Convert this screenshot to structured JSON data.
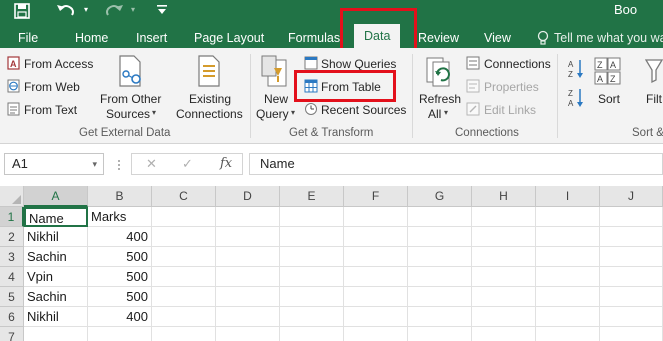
{
  "colors": {
    "accent": "#217346",
    "highlight": "#e3101b",
    "ribbon_bg": "#f3f3f3"
  },
  "quick_access": {
    "save_icon": "save-icon",
    "undo_icon": "undo-icon",
    "redo_icon": "redo-icon"
  },
  "window": {
    "title": "Boo"
  },
  "tabs": [
    {
      "label": "File"
    },
    {
      "label": "Home"
    },
    {
      "label": "Insert"
    },
    {
      "label": "Page Layout"
    },
    {
      "label": "Formulas"
    },
    {
      "label": "Data",
      "active": true
    },
    {
      "label": "Review"
    },
    {
      "label": "View"
    }
  ],
  "tell_me": "Tell me what you wa",
  "ribbon": {
    "get_external": {
      "from_access": "From Access",
      "from_web": "From Web",
      "from_text": "From Text",
      "from_other_1": "From Other",
      "from_other_2": "Sources",
      "existing_1": "Existing",
      "existing_2": "Connections",
      "label": "Get External Data"
    },
    "transform": {
      "new_query_1": "New",
      "new_query_2": "Query",
      "show_queries": "Show Queries",
      "from_table": "From Table",
      "recent_sources": "Recent Sources",
      "label": "Get & Transform"
    },
    "connections": {
      "refresh_1": "Refresh",
      "refresh_2": "All",
      "connections": "Connections",
      "properties": "Properties",
      "edit_links": "Edit Links",
      "label": "Connections"
    },
    "sort": {
      "sort": "Sort",
      "filter": "Filt",
      "label": "Sort &"
    }
  },
  "formula_bar": {
    "name_box": "A1",
    "fx": "fx",
    "content": "Name"
  },
  "sheet": {
    "columns": [
      "A",
      "B",
      "C",
      "D",
      "E",
      "F",
      "G",
      "H",
      "I",
      "J"
    ],
    "rows": [
      {
        "num": "1",
        "a": "Name",
        "b": "Marks"
      },
      {
        "num": "2",
        "a": "Nikhil",
        "b": "400"
      },
      {
        "num": "3",
        "a": "Sachin",
        "b": "500"
      },
      {
        "num": "4",
        "a": "Vpin",
        "b": "500"
      },
      {
        "num": "5",
        "a": "Sachin",
        "b": "500"
      },
      {
        "num": "6",
        "a": "Nikhil",
        "b": "400"
      },
      {
        "num": "7",
        "a": "",
        "b": ""
      }
    ]
  }
}
